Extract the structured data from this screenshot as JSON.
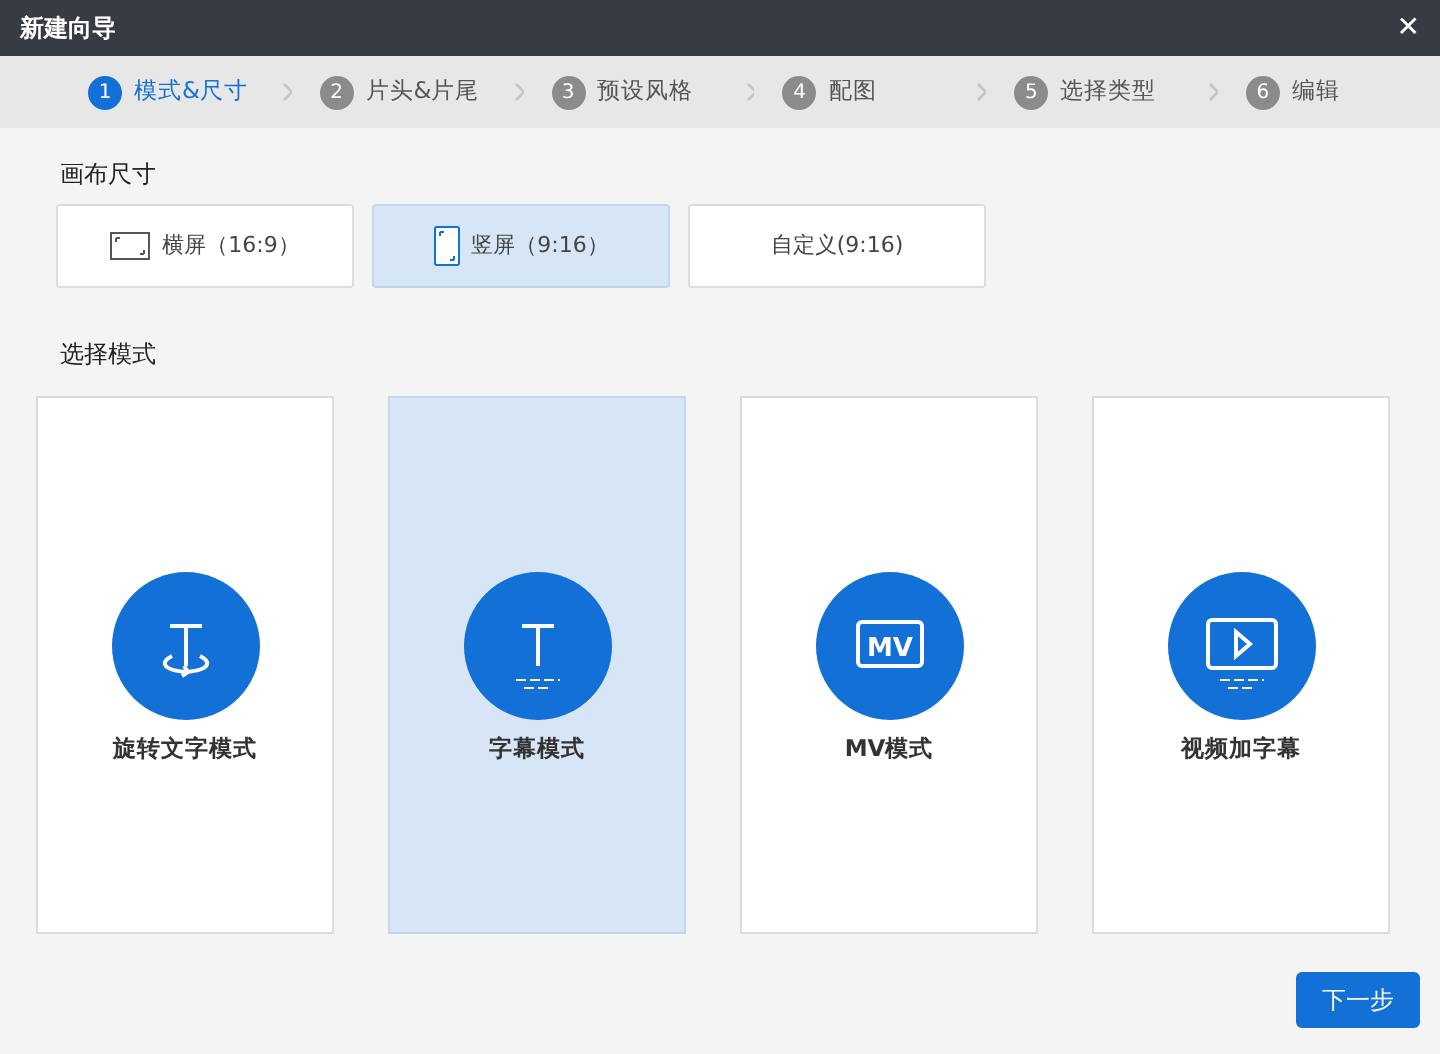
{
  "window": {
    "title": "新建向导",
    "close": "✕"
  },
  "steps": [
    {
      "number": "1",
      "label": "模式&尺寸",
      "selected": true
    },
    {
      "number": "2",
      "label": "片头&片尾",
      "selected": false
    },
    {
      "number": "3",
      "label": "预设风格",
      "selected": false
    },
    {
      "number": "4",
      "label": "配图",
      "selected": false
    },
    {
      "number": "5",
      "label": "选择类型",
      "selected": false
    },
    {
      "number": "6",
      "label": "编辑",
      "selected": false
    }
  ],
  "canvas_size": {
    "heading": "画布尺寸",
    "options": [
      {
        "kind": "landscape",
        "label": "横屏（16:9）",
        "selected": false
      },
      {
        "kind": "portrait",
        "label": "竖屏（9:16）",
        "selected": true
      },
      {
        "kind": "custom",
        "label": "自定义(9:16)",
        "selected": false
      }
    ]
  },
  "mode": {
    "heading": "选择模式",
    "options": [
      {
        "kind": "rotate",
        "label": "旋转文字模式",
        "selected": false
      },
      {
        "kind": "subtitle",
        "label": "字幕模式",
        "selected": true
      },
      {
        "kind": "mv",
        "icon_text": "MV",
        "label": "MV模式",
        "selected": false
      },
      {
        "kind": "video",
        "label": "视频加字幕",
        "selected": false
      }
    ]
  },
  "next_button": "下一步"
}
